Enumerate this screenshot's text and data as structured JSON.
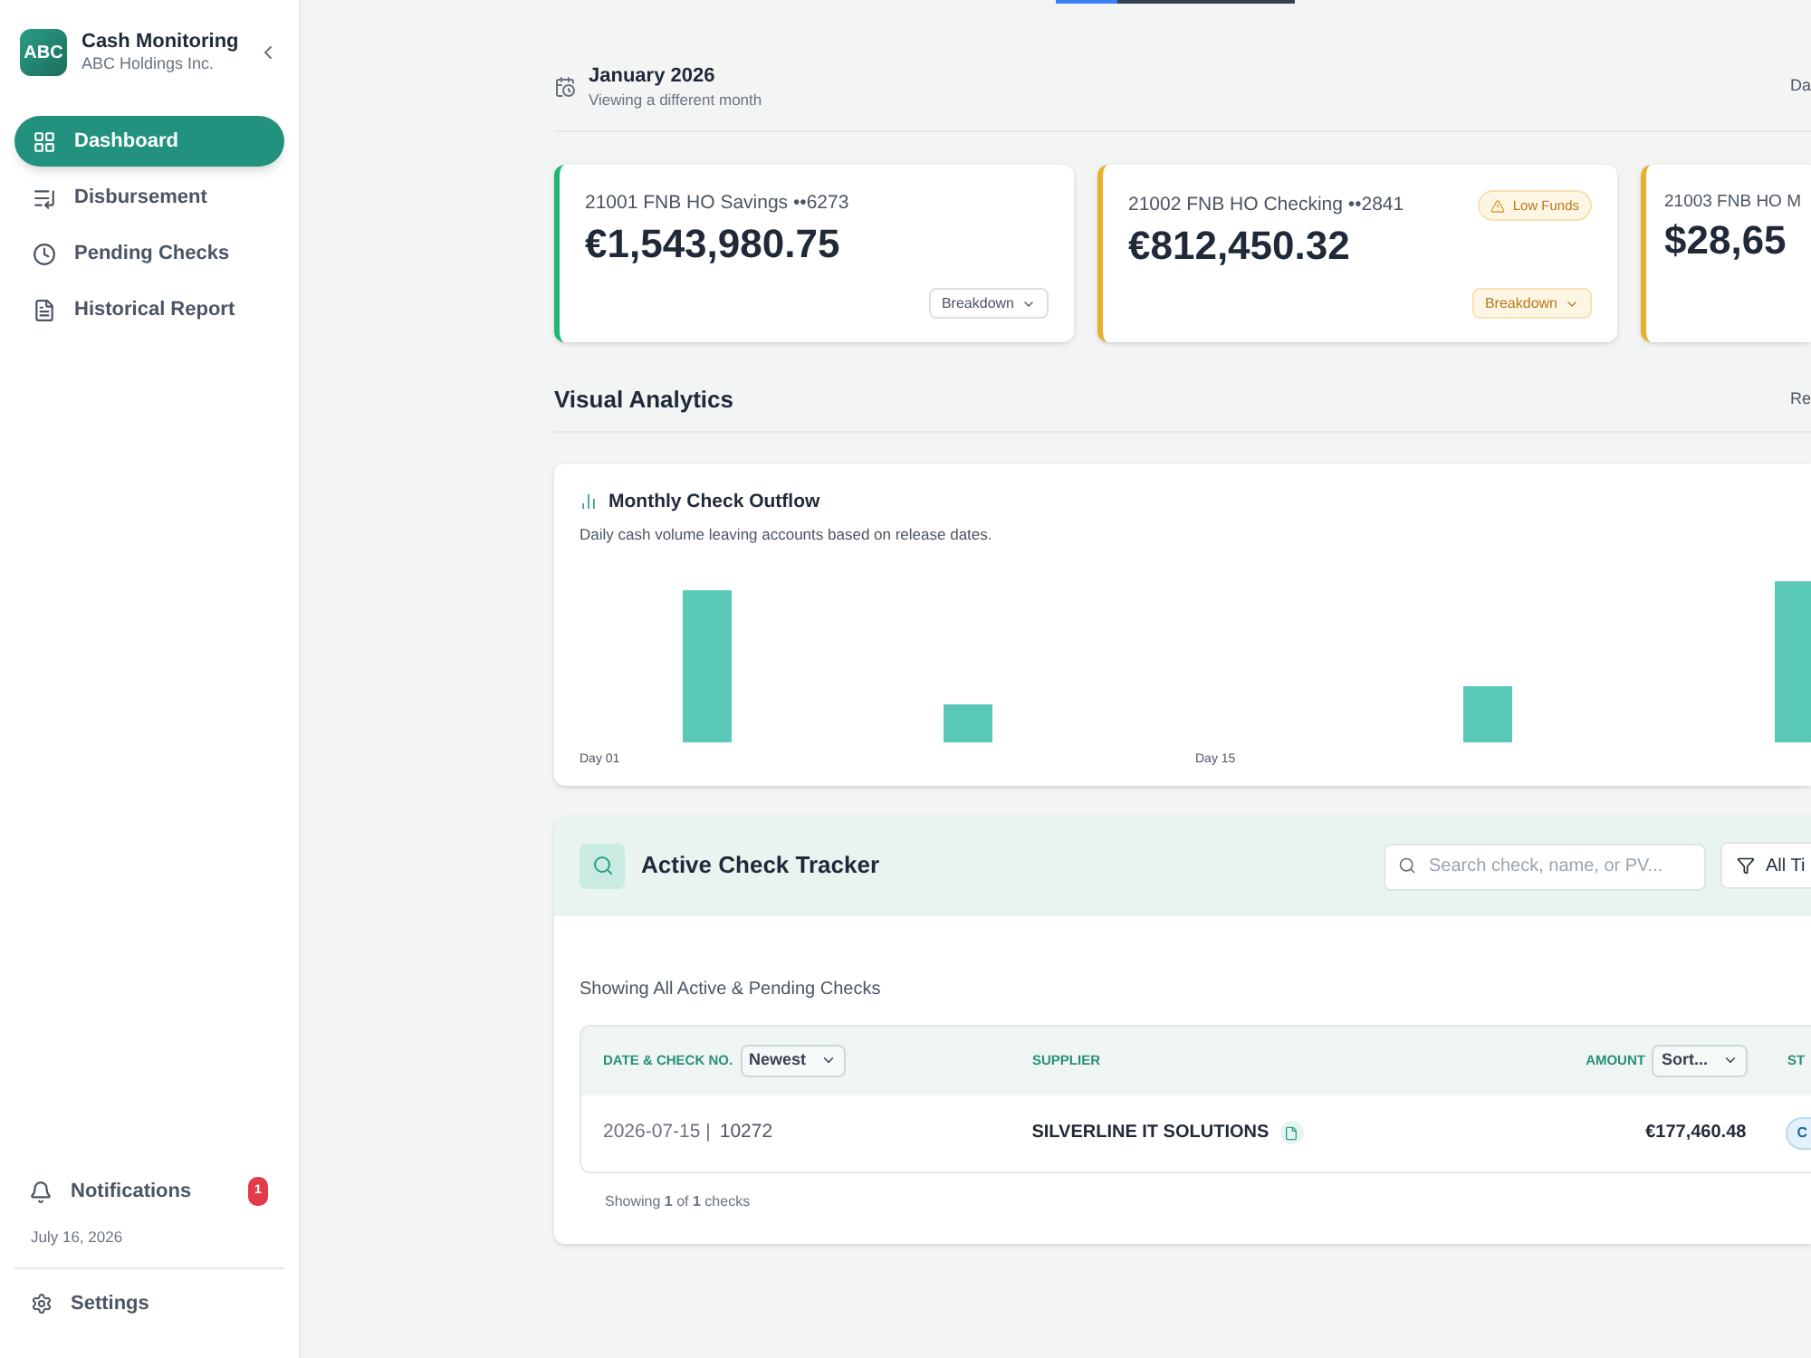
{
  "sidebar": {
    "logo": "ABC",
    "app_name": "Cash Monitoring",
    "company": "ABC Holdings Inc.",
    "items": [
      {
        "label": "Dashboard",
        "selected": true
      },
      {
        "label": "Disbursement",
        "selected": false
      },
      {
        "label": "Pending Checks",
        "selected": false
      },
      {
        "label": "Historical Report",
        "selected": false
      }
    ],
    "notifications": {
      "label": "Notifications",
      "count": "1"
    },
    "date": "July 16, 2026",
    "settings": "Settings"
  },
  "month_header": {
    "title": "January 2026",
    "subtitle": "Viewing a different month",
    "right_text": "Da"
  },
  "accounts": [
    {
      "name": "21001 FNB HO Savings ••6273",
      "balance": "€1,543,980.75",
      "color": "#22b573",
      "button": "Breakdown"
    },
    {
      "name": "21002 FNB HO Checking ••2841",
      "balance": "€812,450.32",
      "color": "#e6b030",
      "warning": "Low Funds",
      "button": "Breakdown"
    },
    {
      "name": "21003 FNB HO M",
      "balance": "$28,65",
      "color": "#e6b030"
    }
  ],
  "analytics": {
    "title": "Visual Analytics",
    "right_text": "Re",
    "chart": {
      "title": "Monthly Check Outflow",
      "subtitle": "Daily cash volume leaving accounts based on release dates.",
      "labels": [
        "Day 01",
        "Day 15"
      ]
    }
  },
  "tracker": {
    "title": "Active Check Tracker",
    "search": {
      "placeholder": "Search check, name, or PV..."
    },
    "filter": "All Ti",
    "caption": "Showing All Active & Pending Checks",
    "columns": [
      {
        "label": "DATE & CHECK NO.",
        "sort": "Newest"
      },
      {
        "label": "SUPPLIER"
      },
      {
        "label": "AMOUNT",
        "sort": "Sort..."
      },
      {
        "label": "ST"
      }
    ],
    "rows": [
      {
        "date": "2026-07-15 |",
        "check": "10272",
        "supplier": "SILVERLINE IT SOLUTIONS",
        "amount": "€177,460.48",
        "status": "C"
      }
    ],
    "footer": "Showing **1** of **1** checks"
  }
}
